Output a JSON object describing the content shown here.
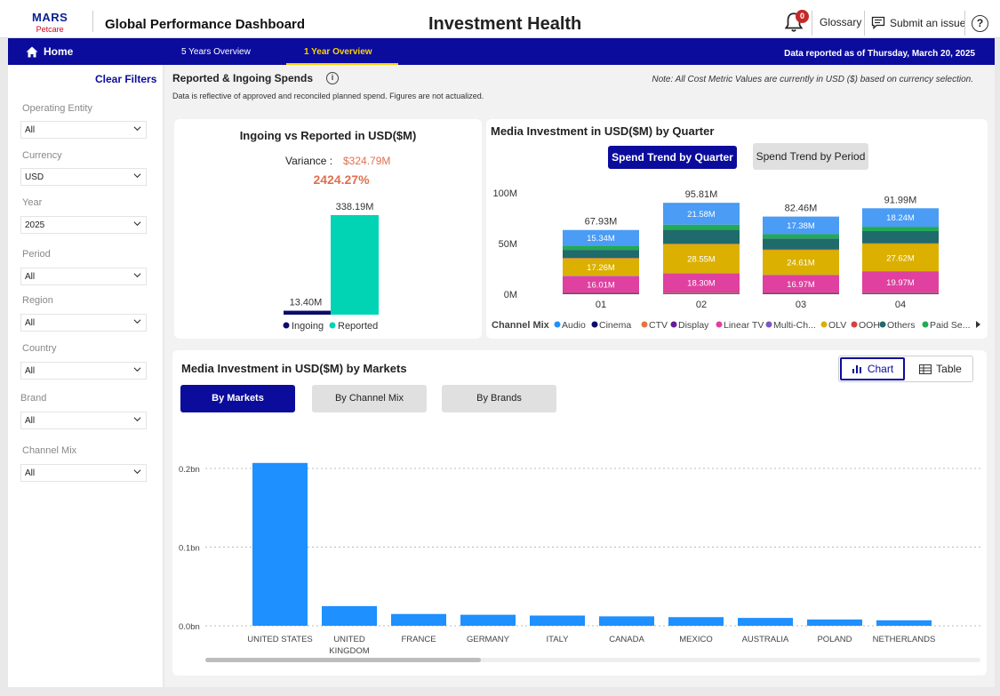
{
  "header": {
    "logo_brand": "MARS",
    "logo_sub": "Petcare",
    "app_title": "Global Performance Dashboard",
    "page_title": "Investment Health",
    "notification_count": "0",
    "glossary_label": "Glossary",
    "submit_label": "Submit an issue",
    "help_symbol": "?"
  },
  "nav": {
    "home_label": "Home",
    "tabs": [
      {
        "label": "5 Years Overview",
        "active": false
      },
      {
        "label": "1 Year Overview",
        "active": true
      }
    ],
    "data_reported": "Data reported as of Thursday, March 20, 2025"
  },
  "sidebar": {
    "clear_filters": "Clear Filters",
    "filters": [
      {
        "label": "Operating Entity",
        "value": "All"
      },
      {
        "label": "Currency",
        "value": "USD"
      },
      {
        "label": "Year",
        "value": "2025"
      },
      {
        "label": "Period",
        "value": "All"
      },
      {
        "label": "Region",
        "value": "All"
      },
      {
        "label": "Country",
        "value": "All"
      },
      {
        "label": "Brand",
        "value": "All"
      },
      {
        "label": "Channel Mix",
        "value": "All"
      }
    ]
  },
  "section": {
    "title": "Reported & Ingoing Spends",
    "subtitle": "Data is reflective of approved and reconciled planned spend. Figures are not actualized.",
    "note": "Note: All Cost Metric Values are currently in USD ($) based on currency selection."
  },
  "ingoing_card": {
    "title": "Ingoing vs Reported in USD($M)",
    "variance_label": "Variance :",
    "variance_value": "$324.79M",
    "variance_pct": "2424.27%",
    "colors": {
      "ingoing": "#0b0c6e",
      "reported": "#00d4b4",
      "variance": "#e07050"
    }
  },
  "quarter_card": {
    "title": "Media Investment in USD($M) by Quarter",
    "buttons": [
      {
        "label": "Spend Trend by Quarter",
        "active": true
      },
      {
        "label": "Spend Trend by Period",
        "active": false
      }
    ],
    "legend_title": "Channel Mix"
  },
  "markets_card": {
    "title": "Media Investment in USD($M) by Markets",
    "tabs": [
      {
        "label": "By Markets",
        "active": true
      },
      {
        "label": "By Channel Mix",
        "active": false
      },
      {
        "label": "By Brands",
        "active": false
      }
    ],
    "view_toggle": [
      {
        "label": "Chart",
        "active": true
      },
      {
        "label": "Table",
        "active": false
      }
    ]
  },
  "chart_data": [
    {
      "type": "bar",
      "title": "Ingoing vs Reported in USD($M)",
      "categories": [
        "Ingoing",
        "Reported"
      ],
      "values": [
        13.4,
        338.19
      ],
      "data_labels": [
        "13.40M",
        "338.19M"
      ],
      "colors": [
        "#0b0c6e",
        "#00d4b4"
      ],
      "legend": [
        "Ingoing",
        "Reported"
      ],
      "legend_position": "bottom"
    },
    {
      "type": "bar",
      "stacked": true,
      "title": "Media Investment in USD($M) by Quarter",
      "categories": [
        "01",
        "02",
        "03",
        "04"
      ],
      "totals": [
        67.93,
        95.81,
        82.46,
        91.99
      ],
      "total_labels": [
        "67.93M",
        "95.81M",
        "82.46M",
        "91.99M"
      ],
      "y_ticks": [
        "0M",
        "50M",
        "100M"
      ],
      "ylim": [
        0,
        100
      ],
      "series": [
        {
          "name": "Audio",
          "color": "#1e90ff",
          "values": [
            0.4,
            0.5,
            0.4,
            0.4
          ]
        },
        {
          "name": "Cinema",
          "color": "#0b0c6e",
          "values": [
            0.1,
            0.1,
            0.1,
            0.1
          ]
        },
        {
          "name": "CTV",
          "color": "#e8743b",
          "values": [
            0.8,
            0.9,
            0.8,
            0.9
          ]
        },
        {
          "name": "Display",
          "color": "#6a1b9a",
          "values": [
            0.5,
            0.6,
            0.5,
            0.6
          ]
        },
        {
          "name": "Linear TV",
          "color": "#e040a0",
          "values": [
            16.01,
            18.3,
            16.97,
            19.97
          ]
        },
        {
          "name": "Multi-Ch...",
          "color": "#7e57c2",
          "values": [
            0.4,
            0.5,
            0.4,
            0.4
          ]
        },
        {
          "name": "OLV",
          "color": "#dbb000",
          "values": [
            17.26,
            28.55,
            24.61,
            27.62
          ]
        },
        {
          "name": "OOH",
          "color": "#d84040",
          "values": [
            0.3,
            0.3,
            0.3,
            0.3
          ]
        },
        {
          "name": "Others",
          "color": "#1f6b6b",
          "values": [
            8.0,
            14.0,
            11.0,
            12.0
          ]
        },
        {
          "name": "Paid Se...",
          "color": "#22aa55",
          "values": [
            4.29,
            4.9,
            4.18,
            4.3
          ]
        },
        {
          "name": "",
          "color": "#4a9cf5",
          "values": [
            15.34,
            21.58,
            17.38,
            18.24
          ]
        }
      ],
      "segment_labels": {
        "Linear TV": [
          "16.01M",
          "18.30M",
          "16.97M",
          "19.97M"
        ],
        "OLV": [
          "17.26M",
          "28.55M",
          "24.61M",
          "27.62M"
        ],
        "top": [
          "15.34M",
          "21.58M",
          "17.38M",
          "18.24M"
        ]
      },
      "legend_position": "bottom"
    },
    {
      "type": "bar",
      "title": "Media Investment in USD($M) by Markets",
      "categories": [
        "UNITED STATES",
        "UNITED KINGDOM",
        "FRANCE",
        "GERMANY",
        "ITALY",
        "CANADA",
        "MEXICO",
        "AUSTRALIA",
        "POLAND",
        "NETHERLANDS"
      ],
      "values": [
        0.207,
        0.025,
        0.015,
        0.014,
        0.013,
        0.012,
        0.011,
        0.01,
        0.008,
        0.007
      ],
      "y_unit": "bn",
      "y_ticks": [
        "0.0bn",
        "0.1bn",
        "0.2bn"
      ],
      "ylim": [
        0,
        0.2
      ],
      "color": "#1e90ff",
      "grid": true
    }
  ]
}
